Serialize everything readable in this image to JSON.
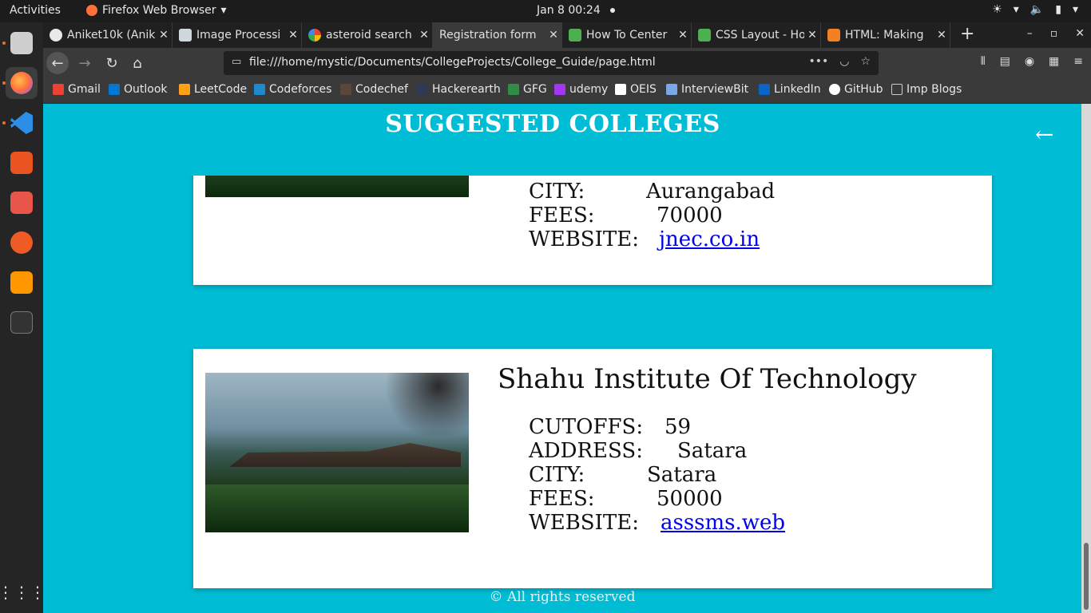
{
  "topbar": {
    "activities": "Activities",
    "app_name": "Firefox Web Browser",
    "clock": "Jan 8  00:24"
  },
  "dock": {
    "items": [
      "files-icon",
      "firefox-icon",
      "vscode-icon",
      "software-icon",
      "package-icon",
      "postman-icon",
      "sublime-icon",
      "terminal-icon",
      "app-grid-icon"
    ]
  },
  "tabs": [
    {
      "title": "Aniket10k (Anik",
      "icon_color": "#e8e8e8"
    },
    {
      "title": "Image Processi",
      "icon_color": "#cfd8dc"
    },
    {
      "title": "asteroid search",
      "icon_color": "#4285f4"
    },
    {
      "title": "Registration form",
      "icon_color": "",
      "active": true
    },
    {
      "title": "How To Center",
      "icon_color": "#4caf50"
    },
    {
      "title": "CSS Layout - Ho",
      "icon_color": "#4caf50"
    },
    {
      "title": "HTML: Making",
      "icon_color": "#f48024"
    }
  ],
  "url": "file:///home/mystic/Documents/CollegeProjects/College_Guide/page.html",
  "bookmarks": [
    {
      "label": "Gmail",
      "color": "#ea4335"
    },
    {
      "label": "Outlook",
      "color": "#0078d4"
    },
    {
      "label": "LeetCode",
      "color": "#ffa116"
    },
    {
      "label": "Codeforces",
      "color": "#1f8acb"
    },
    {
      "label": "Codechef",
      "color": "#5b4638"
    },
    {
      "label": "Hackerearth",
      "color": "#323754"
    },
    {
      "label": "GFG",
      "color": "#2f8d46"
    },
    {
      "label": "udemy",
      "color": "#a435f0"
    },
    {
      "label": "OEIS",
      "color": "#ffffff"
    },
    {
      "label": "InterviewBit",
      "color": "#7aa7e6"
    },
    {
      "label": "LinkedIn",
      "color": "#0a66c2"
    },
    {
      "label": "GitHub",
      "color": "#ffffff"
    },
    {
      "label": "Imp Blogs",
      "color": "#cccccc"
    }
  ],
  "page": {
    "title": "SUGGESTED COLLEGES",
    "footer": "© All rights reserved",
    "colleges": [
      {
        "name": "",
        "city_label": "CITY:",
        "city": "Aurangabad",
        "fees_label": "FEES:",
        "fees": "70000",
        "website_label": "WEBSITE:",
        "website": "jnec.co.in"
      },
      {
        "name": "Shahu Institute Of Technology",
        "cutoffs_label": "CUTOFFS:",
        "cutoffs": "59",
        "address_label": "ADDRESS:",
        "address": "Satara",
        "city_label": "CITY:",
        "city": "Satara",
        "fees_label": "FEES:",
        "fees": "50000",
        "website_label": "WEBSITE:",
        "website": "asssms.web"
      }
    ]
  },
  "colors": {
    "page_bg": "#00bcd4",
    "link": "#0000ee"
  }
}
